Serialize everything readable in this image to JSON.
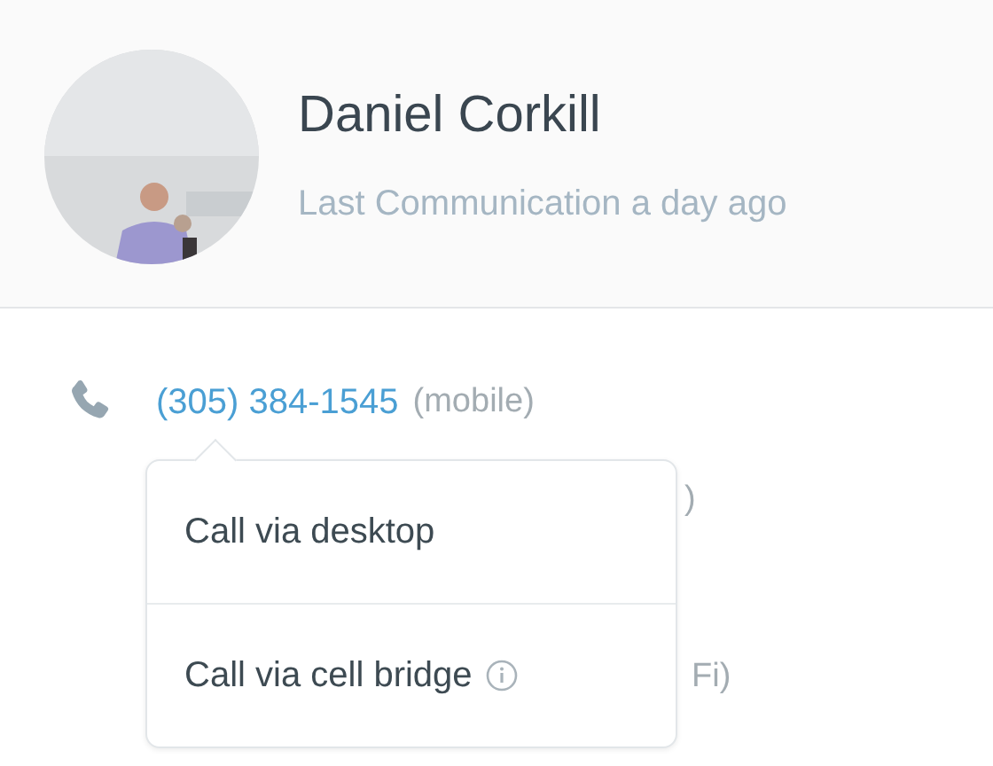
{
  "contact": {
    "name": "Daniel Corkill",
    "last_communication": "Last Communication a day ago"
  },
  "phones": [
    {
      "number": "(305) 384-1545",
      "type": "(mobile)"
    }
  ],
  "hidden_rows": [
    {
      "visible_text": ")"
    },
    {
      "visible_text": "Fi)"
    }
  ],
  "call_menu": {
    "items": [
      {
        "label": "Call via desktop",
        "info": false
      },
      {
        "label": "Call via cell bridge",
        "info": true
      }
    ]
  }
}
